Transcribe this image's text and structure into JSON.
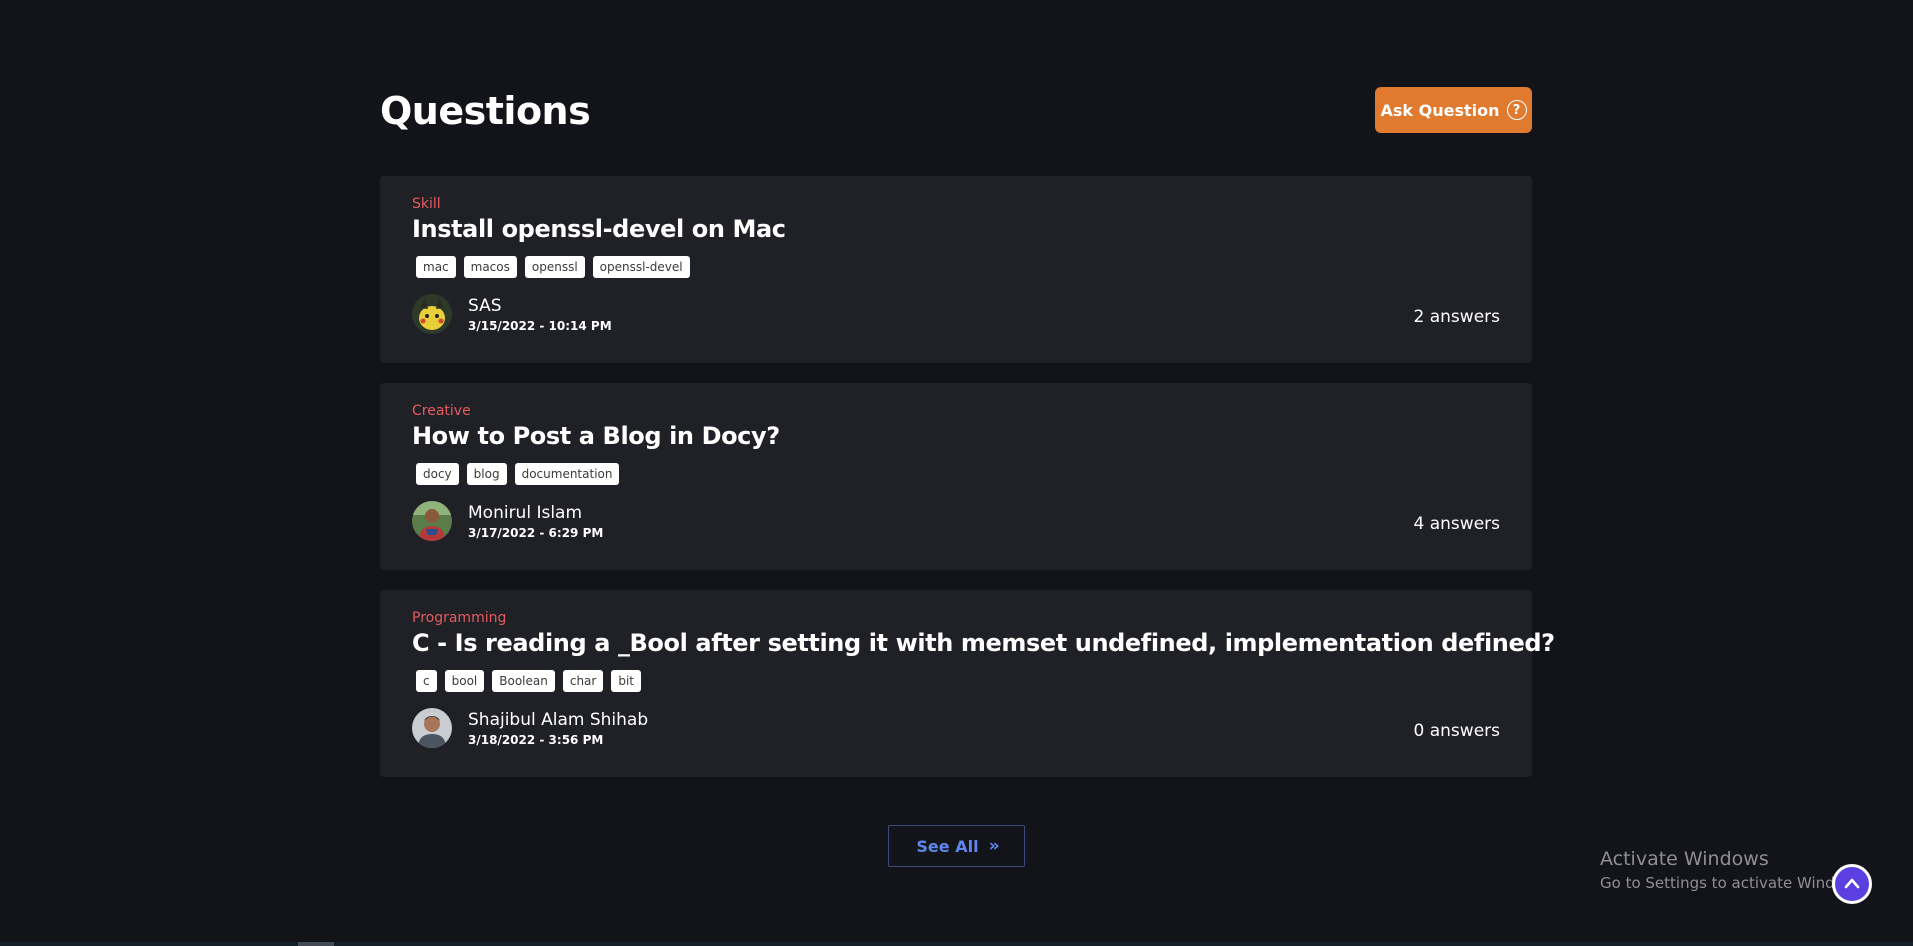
{
  "header": {
    "title": "Questions",
    "ask_label": "Ask Question",
    "ask_icon": "question-circle-icon"
  },
  "questions": [
    {
      "category": "Skill",
      "title": "Install openssl-devel on Mac",
      "tags": [
        "mac",
        "macos",
        "openssl",
        "openssl-devel"
      ],
      "author": "SAS",
      "date": "3/15/2022 - 10:14 PM",
      "answers": "2 answers"
    },
    {
      "category": "Creative",
      "title": "How to Post a Blog in Docy?",
      "tags": [
        "docy",
        "blog",
        "documentation"
      ],
      "author": "Monirul Islam",
      "date": "3/17/2022 - 6:29 PM",
      "answers": "4 answers"
    },
    {
      "category": "Programming",
      "title": "C - Is reading a _Bool after setting it with memset undefined, implementation defined?",
      "tags": [
        "c",
        "bool",
        "Boolean",
        "char",
        "bit"
      ],
      "author": "Shajibul Alam Shihab",
      "date": "3/18/2022 - 3:56 PM",
      "answers": "0 answers"
    }
  ],
  "see_all": {
    "label": "See All",
    "icon": "double-chevron-right-icon"
  },
  "watermark": {
    "line1": "Activate Windows",
    "line2": "Go to Settings to activate Windows."
  },
  "scroll_top_icon": "chevron-up-icon",
  "colors": {
    "background": "#131419",
    "card": "#202127",
    "accent_orange": "#e07a2f",
    "category_red": "#e45a5e",
    "link_blue": "#5f86ee",
    "scroll_button": "#5b3fe0"
  }
}
